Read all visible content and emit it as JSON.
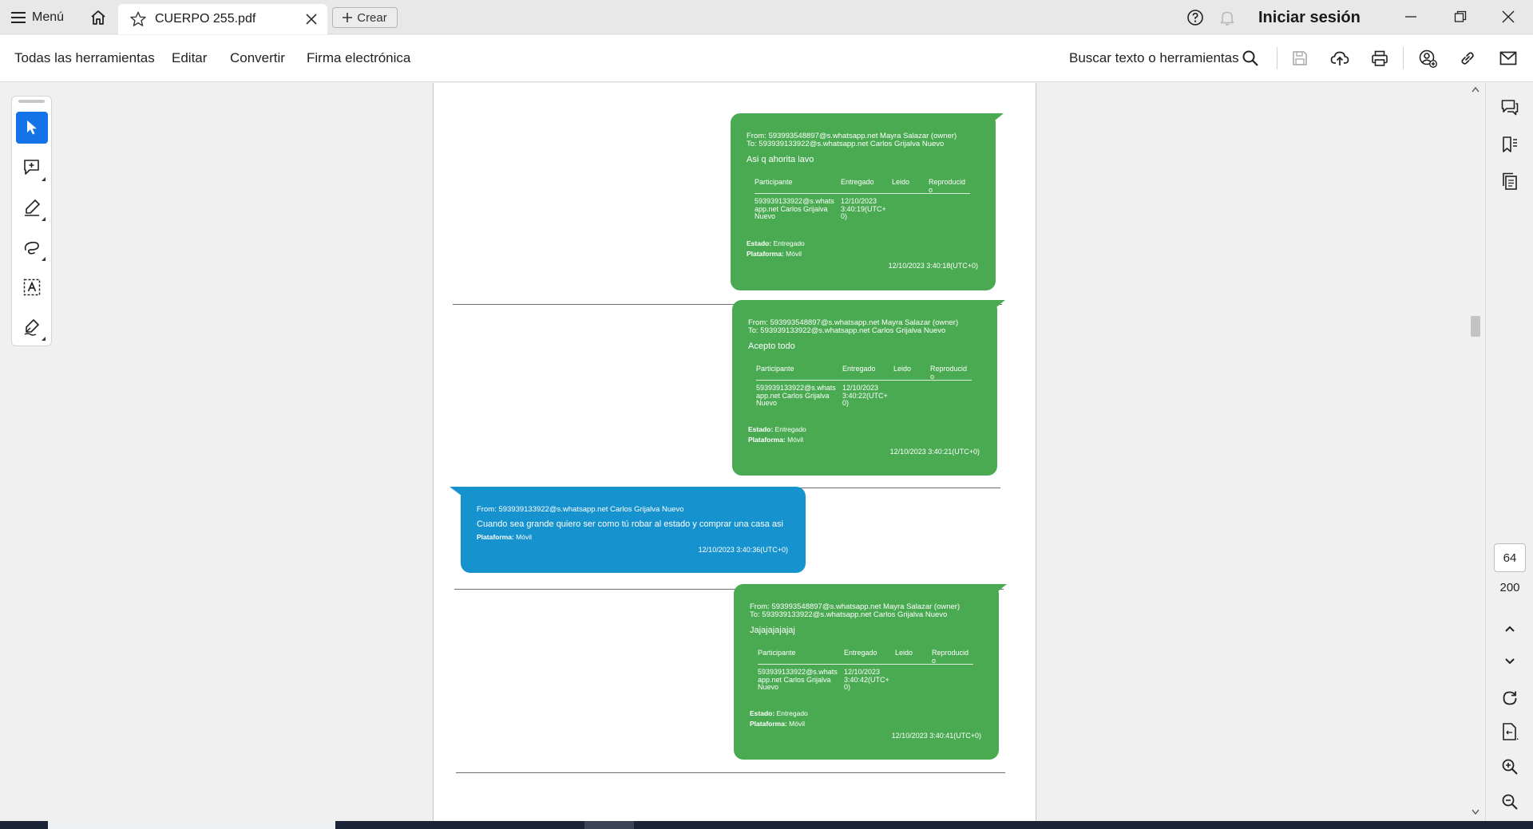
{
  "titlebar": {
    "menu_label": "Menú",
    "tab_title": "CUERPO 255.pdf",
    "create_label": "Crear",
    "signin_label": "Iniciar sesión"
  },
  "toolbar": {
    "items": [
      "Todas las herramientas",
      "Editar",
      "Convertir",
      "Firma electrónica"
    ],
    "search_label": "Buscar texto o herramientas"
  },
  "document": {
    "messages": [
      {
        "type": "outgoing",
        "from": "From: 593993548897@s.whatsapp.net Mayra Salazar (owner)",
        "to": "To: 593939133922@s.whatsapp.net Carlos Grijalva Nuevo",
        "body": "Asi q ahorita lavo",
        "headers": [
          "Participante",
          "Entregado",
          "Leido",
          "Reproducid o"
        ],
        "participant": "593939133922@s.whats app.net Carlos Grijalva Nuevo",
        "delivered": "12/10/2023 3:40:19(UTC+ 0)",
        "estado_label": "Estado:",
        "estado": "Entregado",
        "plataforma_label": "Plataforma:",
        "plataforma": "Móvil",
        "timestamp": "12/10/2023 3:40:18(UTC+0)"
      },
      {
        "type": "outgoing",
        "from": "From: 593993548897@s.whatsapp.net Mayra Salazar (owner)",
        "to": "To: 593939133922@s.whatsapp.net Carlos Grijalva Nuevo",
        "body": "Acepto todo",
        "headers": [
          "Participante",
          "Entregado",
          "Leido",
          "Reproducid o"
        ],
        "participant": "593939133922@s.whats app.net Carlos Grijalva Nuevo",
        "delivered": "12/10/2023 3:40:22(UTC+ 0)",
        "estado_label": "Estado:",
        "estado": "Entregado",
        "plataforma_label": "Plataforma:",
        "plataforma": "Móvil",
        "timestamp": "12/10/2023 3:40:21(UTC+0)"
      },
      {
        "type": "incoming",
        "from": "From: 593939133922@s.whatsapp.net Carlos Grijalva Nuevo",
        "body": "Cuando sea grande quiero ser como tú robar al estado y comprar una casa asi",
        "plataforma_label": "Plataforma:",
        "plataforma": "Móvil",
        "timestamp": "12/10/2023 3:40:36(UTC+0)"
      },
      {
        "type": "outgoing",
        "from": "From: 593993548897@s.whatsapp.net Mayra Salazar (owner)",
        "to": "To: 593939133922@s.whatsapp.net Carlos Grijalva Nuevo",
        "body": "Jajajajajajaj",
        "headers": [
          "Participante",
          "Entregado",
          "Leido",
          "Reproducid o"
        ],
        "participant": "593939133922@s.whats app.net Carlos Grijalva Nuevo",
        "delivered": "12/10/2023 3:40:42(UTC+ 0)",
        "estado_label": "Estado:",
        "estado": "Entregado",
        "plataforma_label": "Plataforma:",
        "plataforma": "Móvil",
        "timestamp": "12/10/2023 3:40:41(UTC+0)"
      }
    ]
  },
  "pager": {
    "current": "64",
    "total": "200"
  },
  "colors": {
    "accent": "#1473e6",
    "outgoing_bubble": "#4aaa52",
    "incoming_bubble": "#1692cf"
  }
}
